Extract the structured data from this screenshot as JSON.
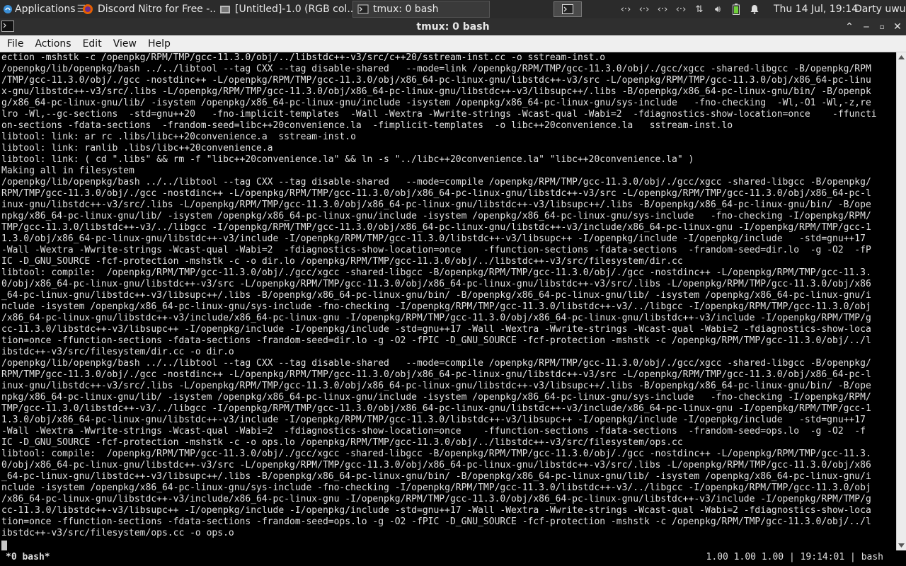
{
  "panel": {
    "applications_label": "Applications",
    "tasks": [
      {
        "label": "Discord Nitro for Free -...",
        "icon": "firefox-icon"
      },
      {
        "label": "[Untitled]-1.0 (RGB col...",
        "icon": "gimp-icon"
      },
      {
        "label": "tmux: 0 bash",
        "icon": "terminal-icon"
      }
    ],
    "clock": "Thu 14 Jul, 19:14",
    "user": "Darty uwu"
  },
  "window": {
    "title": "tmux: 0 bash"
  },
  "menu": [
    "File",
    "Actions",
    "Edit",
    "View",
    "Help"
  ],
  "terminal": {
    "lines": [
      "ection -mshstk -c /openpkg/RPM/TMP/gcc-11.3.0/obj/../libstdc++-v3/src/c++20/sstream-inst.cc -o sstream-inst.o",
      "/openpkg/lib/openpkg/bash ../../libtool --tag CXX --tag disable-shared   --mode=link /openpkg/RPM/TMP/gcc-11.3.0/obj/./gcc/xgcc -shared-libgcc -B/openpkg/RPM",
      "/TMP/gcc-11.3.0/obj/./gcc -nostdinc++ -L/openpkg/RPM/TMP/gcc-11.3.0/obj/x86_64-pc-linux-gnu/libstdc++-v3/src -L/openpkg/RPM/TMP/gcc-11.3.0/obj/x86_64-pc-linu",
      "x-gnu/libstdc++-v3/src/.libs -L/openpkg/RPM/TMP/gcc-11.3.0/obj/x86_64-pc-linux-gnu/libstdc++-v3/libsupc++/.libs -B/openpkg/x86_64-pc-linux-gnu/bin/ -B/openpk",
      "g/x86_64-pc-linux-gnu/lib/ -isystem /openpkg/x86_64-pc-linux-gnu/include -isystem /openpkg/x86_64-pc-linux-gnu/sys-include   -fno-checking  -Wl,-O1 -Wl,-z,re",
      "lro -Wl,--gc-sections  -std=gnu++20   -fno-implicit-templates  -Wall -Wextra -Wwrite-strings -Wcast-qual -Wabi=2  -fdiagnostics-show-location=once    -ffuncti",
      "on-sections -fdata-sections  -frandom-seed=libc++20convenience.la  -fimplicit-templates  -o libc++20convenience.la   sstream-inst.lo",
      "libtool: link: ar rc .libs/libc++20convenience.a  sstream-inst.o",
      "libtool: link: ranlib .libs/libc++20convenience.a",
      "libtool: link: ( cd \".libs\" && rm -f \"libc++20convenience.la\" && ln -s \"../libc++20convenience.la\" \"libc++20convenience.la\" )",
      "Making all in filesystem",
      "/openpkg/lib/openpkg/bash ../../libtool --tag CXX --tag disable-shared   --mode=compile /openpkg/RPM/TMP/gcc-11.3.0/obj/./gcc/xgcc -shared-libgcc -B/openpkg/",
      "RPM/TMP/gcc-11.3.0/obj/./gcc -nostdinc++ -L/openpkg/RPM/TMP/gcc-11.3.0/obj/x86_64-pc-linux-gnu/libstdc++-v3/src -L/openpkg/RPM/TMP/gcc-11.3.0/obj/x86_64-pc-l",
      "inux-gnu/libstdc++-v3/src/.libs -L/openpkg/RPM/TMP/gcc-11.3.0/obj/x86_64-pc-linux-gnu/libstdc++-v3/libsupc++/.libs -B/openpkg/x86_64-pc-linux-gnu/bin/ -B/ope",
      "npkg/x86_64-pc-linux-gnu/lib/ -isystem /openpkg/x86_64-pc-linux-gnu/include -isystem /openpkg/x86_64-pc-linux-gnu/sys-include   -fno-checking -I/openpkg/RPM/",
      "TMP/gcc-11.3.0/libstdc++-v3/../libgcc -I/openpkg/RPM/TMP/gcc-11.3.0/obj/x86_64-pc-linux-gnu/libstdc++-v3/include/x86_64-pc-linux-gnu -I/openpkg/RPM/TMP/gcc-1",
      "1.3.0/obj/x86_64-pc-linux-gnu/libstdc++-v3/include -I/openpkg/RPM/TMP/gcc-11.3.0/libstdc++-v3/libsupc++ -I/openpkg/include -I/openpkg/include   -std=gnu++17",
      "-Wall -Wextra -Wwrite-strings -Wcast-qual -Wabi=2  -fdiagnostics-show-location=once    -ffunction-sections -fdata-sections  -frandom-seed=dir.lo  -g -O2  -fP",
      "IC -D_GNU_SOURCE -fcf-protection -mshstk -c -o dir.lo /openpkg/RPM/TMP/gcc-11.3.0/obj/../libstdc++-v3/src/filesystem/dir.cc",
      "libtool: compile:  /openpkg/RPM/TMP/gcc-11.3.0/obj/./gcc/xgcc -shared-libgcc -B/openpkg/RPM/TMP/gcc-11.3.0/obj/./gcc -nostdinc++ -L/openpkg/RPM/TMP/gcc-11.3.",
      "0/obj/x86_64-pc-linux-gnu/libstdc++-v3/src -L/openpkg/RPM/TMP/gcc-11.3.0/obj/x86_64-pc-linux-gnu/libstdc++-v3/src/.libs -L/openpkg/RPM/TMP/gcc-11.3.0/obj/x86",
      "_64-pc-linux-gnu/libstdc++-v3/libsupc++/.libs -B/openpkg/x86_64-pc-linux-gnu/bin/ -B/openpkg/x86_64-pc-linux-gnu/lib/ -isystem /openpkg/x86_64-pc-linux-gnu/i",
      "nclude -isystem /openpkg/x86_64-pc-linux-gnu/sys-include -fno-checking -I/openpkg/RPM/TMP/gcc-11.3.0/libstdc++-v3/../libgcc -I/openpkg/RPM/TMP/gcc-11.3.0/obj",
      "/x86_64-pc-linux-gnu/libstdc++-v3/include/x86_64-pc-linux-gnu -I/openpkg/RPM/TMP/gcc-11.3.0/obj/x86_64-pc-linux-gnu/libstdc++-v3/include -I/openpkg/RPM/TMP/g",
      "cc-11.3.0/libstdc++-v3/libsupc++ -I/openpkg/include -I/openpkg/include -std=gnu++17 -Wall -Wextra -Wwrite-strings -Wcast-qual -Wabi=2 -fdiagnostics-show-loca",
      "tion=once -ffunction-sections -fdata-sections -frandom-seed=dir.lo -g -O2 -fPIC -D_GNU_SOURCE -fcf-protection -mshstk -c /openpkg/RPM/TMP/gcc-11.3.0/obj/../l",
      "ibstdc++-v3/src/filesystem/dir.cc -o dir.o",
      "/openpkg/lib/openpkg/bash ../../libtool --tag CXX --tag disable-shared   --mode=compile /openpkg/RPM/TMP/gcc-11.3.0/obj/./gcc/xgcc -shared-libgcc -B/openpkg/",
      "RPM/TMP/gcc-11.3.0/obj/./gcc -nostdinc++ -L/openpkg/RPM/TMP/gcc-11.3.0/obj/x86_64-pc-linux-gnu/libstdc++-v3/src -L/openpkg/RPM/TMP/gcc-11.3.0/obj/x86_64-pc-l",
      "inux-gnu/libstdc++-v3/src/.libs -L/openpkg/RPM/TMP/gcc-11.3.0/obj/x86_64-pc-linux-gnu/libstdc++-v3/libsupc++/.libs -B/openpkg/x86_64-pc-linux-gnu/bin/ -B/ope",
      "npkg/x86_64-pc-linux-gnu/lib/ -isystem /openpkg/x86_64-pc-linux-gnu/include -isystem /openpkg/x86_64-pc-linux-gnu/sys-include   -fno-checking -I/openpkg/RPM/",
      "TMP/gcc-11.3.0/libstdc++-v3/../libgcc -I/openpkg/RPM/TMP/gcc-11.3.0/obj/x86_64-pc-linux-gnu/libstdc++-v3/include/x86_64-pc-linux-gnu -I/openpkg/RPM/TMP/gcc-1",
      "1.3.0/obj/x86_64-pc-linux-gnu/libstdc++-v3/include -I/openpkg/RPM/TMP/gcc-11.3.0/libstdc++-v3/libsupc++ -I/openpkg/include -I/openpkg/include   -std=gnu++17",
      "-Wall -Wextra -Wwrite-strings -Wcast-qual -Wabi=2  -fdiagnostics-show-location=once    -ffunction-sections -fdata-sections  -frandom-seed=ops.lo  -g -O2  -f",
      "IC -D_GNU_SOURCE -fcf-protection -mshstk -c -o ops.lo /openpkg/RPM/TMP/gcc-11.3.0/obj/../libstdc++-v3/src/filesystem/ops.cc",
      "libtool: compile:  /openpkg/RPM/TMP/gcc-11.3.0/obj/./gcc/xgcc -shared-libgcc -B/openpkg/RPM/TMP/gcc-11.3.0/obj/./gcc -nostdinc++ -L/openpkg/RPM/TMP/gcc-11.3.",
      "0/obj/x86_64-pc-linux-gnu/libstdc++-v3/src -L/openpkg/RPM/TMP/gcc-11.3.0/obj/x86_64-pc-linux-gnu/libstdc++-v3/src/.libs -L/openpkg/RPM/TMP/gcc-11.3.0/obj/x86",
      "_64-pc-linux-gnu/libstdc++-v3/libsupc++/.libs -B/openpkg/x86_64-pc-linux-gnu/bin/ -B/openpkg/x86_64-pc-linux-gnu/lib/ -isystem /openpkg/x86_64-pc-linux-gnu/i",
      "nclude -isystem /openpkg/x86_64-pc-linux-gnu/sys-include -fno-checking -I/openpkg/RPM/TMP/gcc-11.3.0/libstdc++-v3/../libgcc -I/openpkg/RPM/TMP/gcc-11.3.0/obj",
      "/x86_64-pc-linux-gnu/libstdc++-v3/include/x86_64-pc-linux-gnu -I/openpkg/RPM/TMP/gcc-11.3.0/obj/x86_64-pc-linux-gnu/libstdc++-v3/include -I/openpkg/RPM/TMP/g",
      "cc-11.3.0/libstdc++-v3/libsupc++ -I/openpkg/include -I/openpkg/include -std=gnu++17 -Wall -Wextra -Wwrite-strings -Wcast-qual -Wabi=2 -fdiagnostics-show-loca",
      "tion=once -ffunction-sections -fdata-sections -frandom-seed=ops.lo -g -O2 -fPIC -D_GNU_SOURCE -fcf-protection -mshstk -c /openpkg/RPM/TMP/gcc-11.3.0/obj/../l",
      "ibstdc++-v3/src/filesystem/ops.cc -o ops.o"
    ]
  },
  "status": {
    "window": "*0 bash*",
    "right": "1.00 1.00 1.00 | 19:14:01 | bash"
  }
}
